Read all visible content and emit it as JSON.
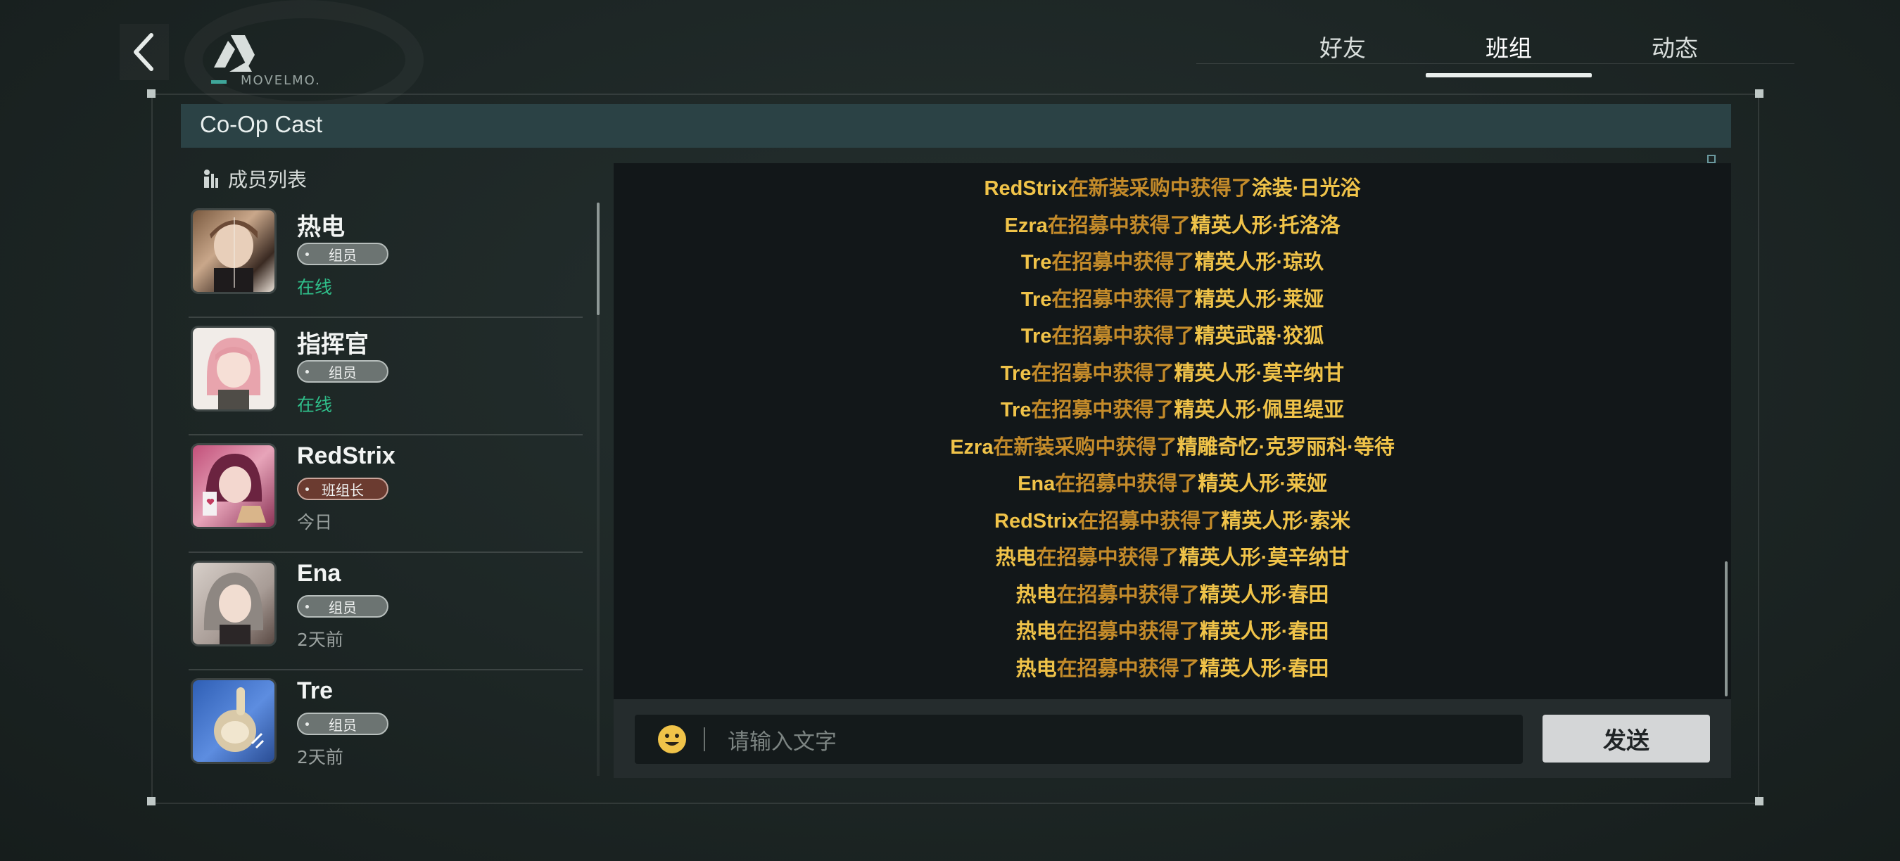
{
  "header": {
    "logo_text": "MOVELMO.",
    "tabs": [
      {
        "label": "好友",
        "active": false
      },
      {
        "label": "班组",
        "active": true
      },
      {
        "label": "动态",
        "active": false
      }
    ]
  },
  "group": {
    "title": "Co-Op Cast"
  },
  "members": {
    "title": "成员列表",
    "items": [
      {
        "name": "热电",
        "role": "组员",
        "status": "在线",
        "status_color": "#2fbf8a"
      },
      {
        "name": "指挥官",
        "role": "组员",
        "status": "在线",
        "status_color": "#2fbf8a"
      },
      {
        "name": "RedStrix",
        "role": "班组长",
        "status": "今日",
        "status_color": "#9aa19f"
      },
      {
        "name": "Ena",
        "role": "组员",
        "status": "2天前",
        "status_color": "#9aa19f"
      },
      {
        "name": "Tre",
        "role": "组员",
        "status": "2天前",
        "status_color": "#9aa19f"
      }
    ]
  },
  "chat": {
    "messages": [
      {
        "user": "RedStrix",
        "action": "在新装采购中获得了",
        "item": "涂装·日光浴"
      },
      {
        "user": "Ezra",
        "action": "在招募中获得了",
        "item": "精英人形·托洛洛"
      },
      {
        "user": "Tre",
        "action": "在招募中获得了",
        "item": "精英人形·琼玖"
      },
      {
        "user": "Tre",
        "action": "在招募中获得了",
        "item": "精英人形·莱娅"
      },
      {
        "user": "Tre",
        "action": "在招募中获得了",
        "item": "精英武器·狡狐"
      },
      {
        "user": "Tre",
        "action": "在招募中获得了",
        "item": "精英人形·莫辛纳甘"
      },
      {
        "user": "Tre",
        "action": "在招募中获得了",
        "item": "精英人形·佩里缇亚"
      },
      {
        "user": "Ezra",
        "action": "在新装采购中获得了",
        "item": "精雕奇忆·克罗丽科·等待"
      },
      {
        "user": "Ena",
        "action": "在招募中获得了",
        "item": "精英人形·莱娅"
      },
      {
        "user": "RedStrix",
        "action": "在招募中获得了",
        "item": "精英人形·索米"
      },
      {
        "user": "热电",
        "action": "在招募中获得了",
        "item": "精英人形·莫辛纳甘"
      },
      {
        "user": "热电",
        "action": "在招募中获得了",
        "item": "精英人形·春田"
      },
      {
        "user": "热电",
        "action": "在招募中获得了",
        "item": "精英人形·春田"
      },
      {
        "user": "热电",
        "action": "在招募中获得了",
        "item": "精英人形·春田"
      }
    ],
    "input_placeholder": "请输入文字",
    "send_label": "发送"
  },
  "colors": {
    "accent_gold": "#f0c349",
    "message_text": "#c48b2a",
    "online_green": "#2fbf8a",
    "header_band": "#2b4245"
  }
}
